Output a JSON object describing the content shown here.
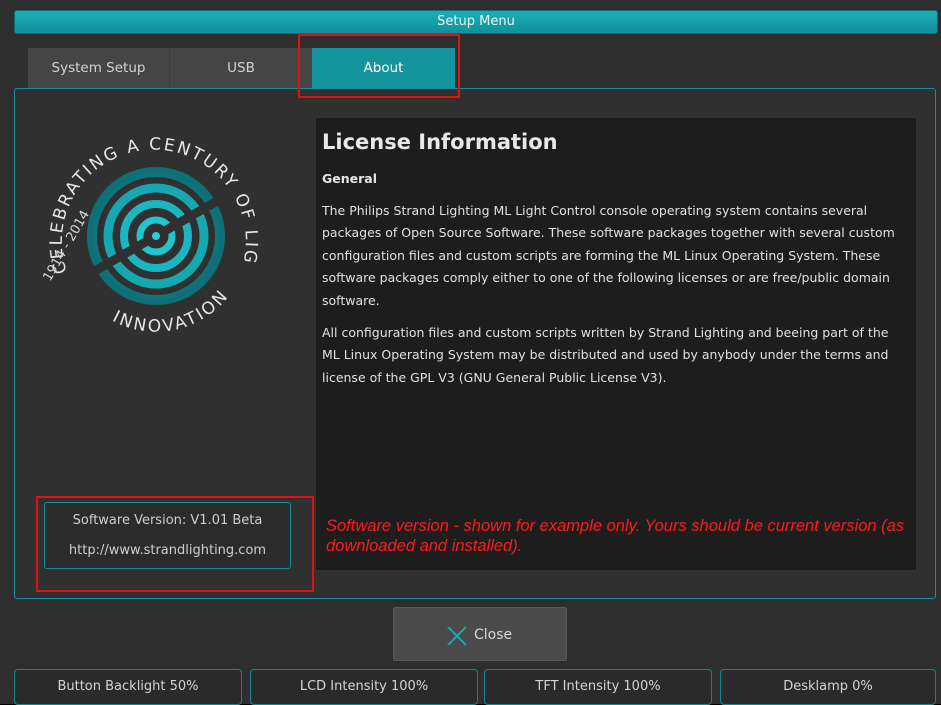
{
  "window": {
    "title": "Setup Menu"
  },
  "tabs": [
    {
      "label": "System Setup",
      "active": false
    },
    {
      "label": "USB",
      "active": false
    },
    {
      "label": "About",
      "active": true
    }
  ],
  "logo": {
    "arc_text_top": "CELEBRATING A CENTURY OF LIGHTING",
    "arc_text_bottom": "INNOVATION",
    "years": "1914 - 2014",
    "accent_color": "#17a7b0"
  },
  "version": {
    "label": "Software Version: V1.01 Beta",
    "url": "http://www.strandlighting.com"
  },
  "license": {
    "title": "License Information",
    "section": "General",
    "paragraphs": [
      "The Philips Strand Lighting ML Light Control console operating system contains several packages of Open Source Software. These software packages together with several custom configuration files and custom scripts are forming the ML Linux Operating System. These software packages comply either to one of the following licenses or are free/public domain software.",
      "All configuration files and custom scripts written by Strand Lighting and beeing part of the ML Linux Operating System may be distributed and used by anybody under the terms and license of the GPL V3 (GNU General Public License V3)."
    ]
  },
  "annotation": {
    "note": "Software version - shown for example only. Yours should be current version (as downloaded and installed).",
    "color": "#ff1a1a"
  },
  "buttons": {
    "close": {
      "label": "Close",
      "icon": "close-x-icon"
    }
  },
  "status_bar": [
    "Button Backlight 50%",
    "LCD Intensity 100%",
    "TFT Intensity 100%",
    "Desklamp 0%"
  ],
  "colors": {
    "accent": "#16949d",
    "highlight": "#e01111",
    "background": "#2e2e2e"
  }
}
